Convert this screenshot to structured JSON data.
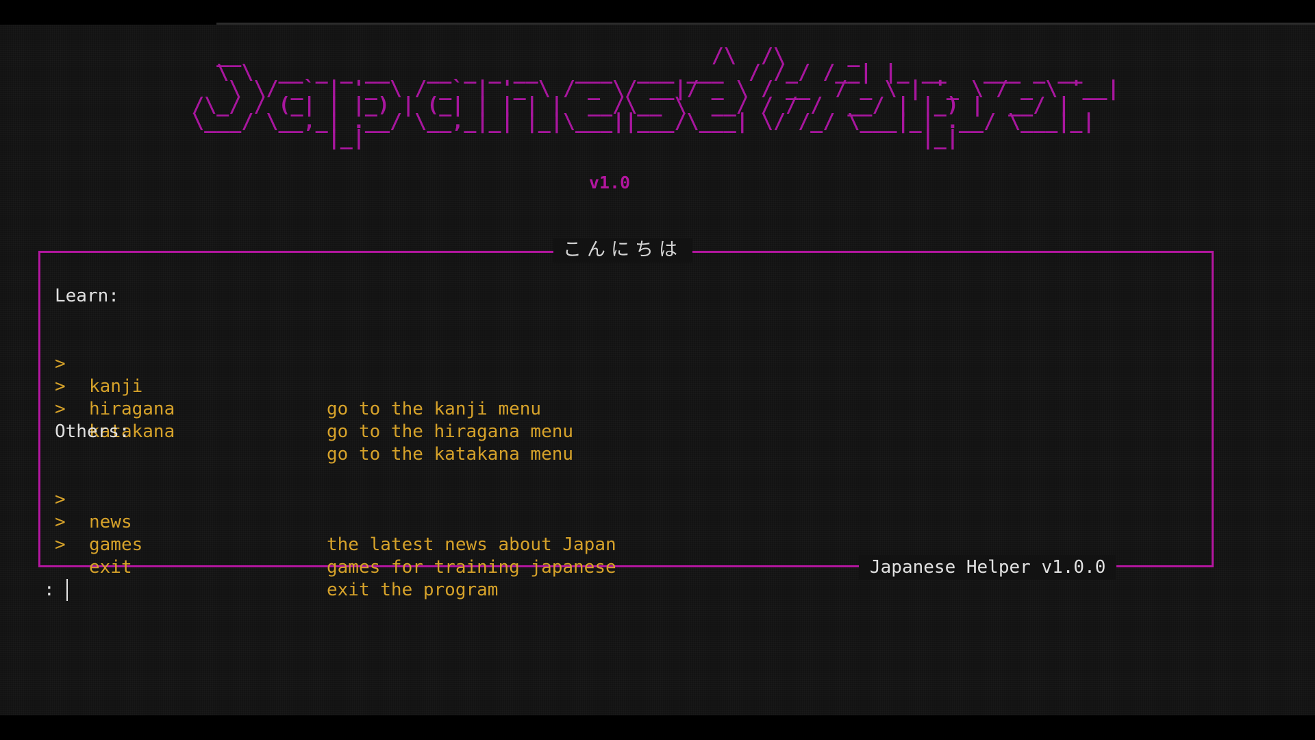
{
  "logo": {
    "ascii": "   __                                      /\\  /\\     _\n   \\ \\  __ _ _ __   __ _ _ __   ___  ___ ___  / /_/ /__| |_ __   ___ _ __\n    \\ \\/ _` | '_ \\ / _` | '_ \\ / _ \\/ __|/ _ \\ / __  / _ \\ | '_ \\ / _ \\ '__|\n /\\_/ / (_| | |_) | (_| | | | |  __/\\__ \\  __/ / / /  __/ | |_) |  __/ |\n \\___/ \\__,_| .__/ \\__,_|_| |_|\\___||___/\\___| \\/ /_/ \\___|_| .__/ \\___|_|\n            |_|                                             |_|",
    "version": "v1.0"
  },
  "box": {
    "title": "こんにちは",
    "footer": "Japanese Helper v1.0.0"
  },
  "sections": {
    "learn": {
      "header": "Learn:",
      "items": [
        {
          "arrow": ">",
          "command": "kanji",
          "description": "go to the kanji menu"
        },
        {
          "arrow": ">",
          "command": "hiragana",
          "description": "go to the hiragana menu"
        },
        {
          "arrow": ">",
          "command": "katakana",
          "description": "go to the katakana menu"
        }
      ]
    },
    "others": {
      "header": "Others:",
      "items": [
        {
          "arrow": ">",
          "command": "news",
          "description": "the latest news about Japan"
        },
        {
          "arrow": ">",
          "command": "games",
          "description": "games for training japanese"
        },
        {
          "arrow": ">",
          "command": "exit",
          "description": "exit the program"
        }
      ]
    }
  },
  "prompt": {
    "symbol": ":"
  },
  "colors": {
    "accent": "#b3169f",
    "menu_text": "#d6a22a",
    "text": "#e0e0e0",
    "background": "#121212"
  }
}
